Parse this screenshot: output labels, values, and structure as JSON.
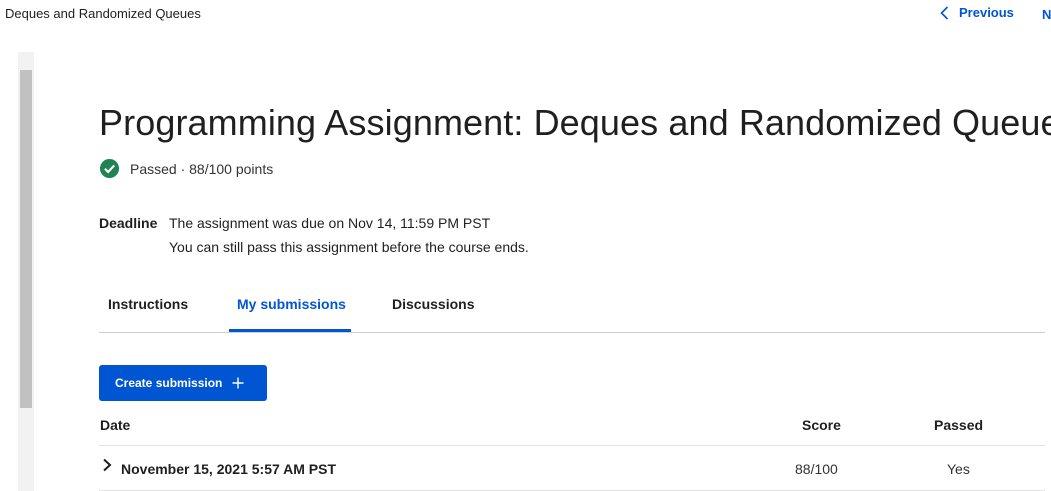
{
  "header": {
    "breadcrumb": "Deques and Randomized Queues",
    "previous_label": "Previous",
    "next_label": "N"
  },
  "assignment": {
    "title": "Programming Assignment: Deques and Randomized Queues",
    "status_text": "Passed · 88/100 points",
    "status_icon": "check-circle-icon",
    "status_color": "#1f8354",
    "deadline_label": "Deadline",
    "deadline_line1": "The assignment was due on Nov 14, 11:59 PM PST",
    "deadline_line2": "You can still pass this assignment before the course ends."
  },
  "tabs": [
    {
      "label": "Instructions",
      "active": false
    },
    {
      "label": "My submissions",
      "active": true
    },
    {
      "label": "Discussions",
      "active": false
    }
  ],
  "create_button": {
    "label": "Create submission",
    "icon": "plus-icon"
  },
  "table": {
    "columns": [
      "Date",
      "Score",
      "Passed"
    ],
    "rows": [
      {
        "date": "November 15, 2021 5:57 AM PST",
        "score": "88/100",
        "passed": "Yes"
      }
    ]
  },
  "colors": {
    "accent": "#0056d2",
    "text": "#1f1f1f",
    "divider": "#e1e1e1"
  }
}
